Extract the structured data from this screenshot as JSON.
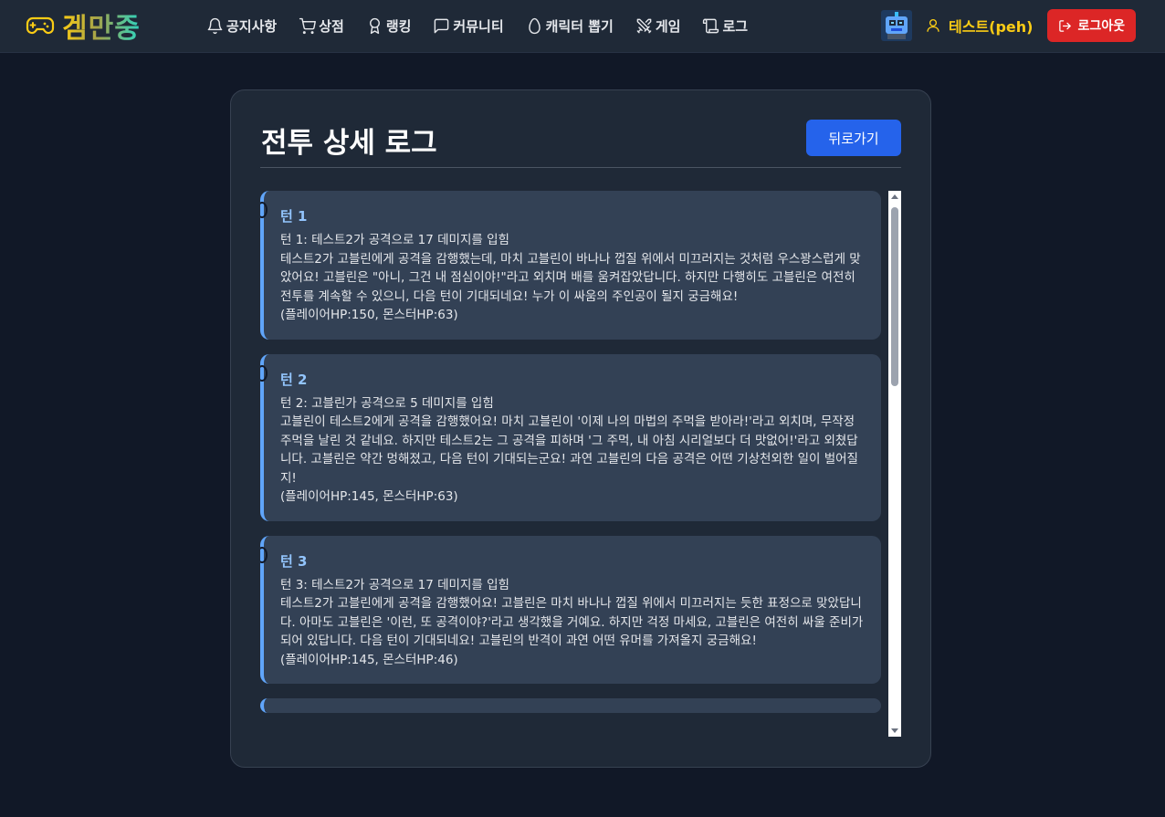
{
  "nav": {
    "logo_text": "겜만중",
    "items": [
      {
        "label": "공지사항",
        "icon": "bell-icon"
      },
      {
        "label": "상점",
        "icon": "cart-icon"
      },
      {
        "label": "랭킹",
        "icon": "medal-icon"
      },
      {
        "label": "커뮤니티",
        "icon": "chat-icon"
      },
      {
        "label": "캐릭터 뽑기",
        "icon": "egg-icon"
      },
      {
        "label": "게임",
        "icon": "swords-icon"
      },
      {
        "label": "로그",
        "icon": "scroll-icon"
      }
    ],
    "user_name": "테스트(peh)",
    "logout_label": "로그아웃"
  },
  "page": {
    "title": "전투 상세 로그",
    "back_label": "뒤로가기"
  },
  "logs": [
    {
      "turn": "턴 1",
      "summary": "턴 1: 테스트2가 공격으로 17 데미지를 입힘",
      "description": "테스트2가 고블린에게 공격을 감행했는데, 마치 고블린이 바나나 껍질 위에서 미끄러지는 것처럼 우스꽝스럽게 맞았어요! 고블린은 \"아니, 그건 내 점심이야!\"라고 외치며 배를 움켜잡았답니다. 하지만 다행히도 고블린은 여전히 전투를 계속할 수 있으니, 다음 턴이 기대되네요! 누가 이 싸움의 주인공이 될지 궁금해요!",
      "hp": "(플레이어HP:150, 몬스터HP:63)"
    },
    {
      "turn": "턴 2",
      "summary": "턴 2: 고블린가 공격으로 5 데미지를 입힘",
      "description": "고블린이 테스트2에게 공격을 감행했어요! 마치 고블린이 '이제 나의 마법의 주먹을 받아라!'라고 외치며, 무작정 주먹을 날린 것 같네요. 하지만 테스트2는 그 공격을 피하며 '그 주먹, 내 아침 시리얼보다 더 맛없어!'라고 외쳤답니다. 고블린은 약간 멍해졌고, 다음 턴이 기대되는군요! 과연 고블린의 다음 공격은 어떤 기상천외한 일이 벌어질지!",
      "hp": "(플레이어HP:145, 몬스터HP:63)"
    },
    {
      "turn": "턴 3",
      "summary": "턴 3: 테스트2가 공격으로 17 데미지를 입힘",
      "description": "테스트2가 고블린에게 공격을 감행했어요! 고블린은 마치 바나나 껍질 위에서 미끄러지는 듯한 표정으로 맞았답니다. 아마도 고블린은 '이런, 또 공격이야?'라고 생각했을 거예요. 하지만 걱정 마세요, 고블린은 여전히 싸울 준비가 되어 있답니다. 다음 턴이 기대되네요! 고블린의 반격이 과연 어떤 유머를 가져올지 궁금해요!",
      "hp": "(플레이어HP:145, 몬스터HP:46)"
    }
  ]
}
